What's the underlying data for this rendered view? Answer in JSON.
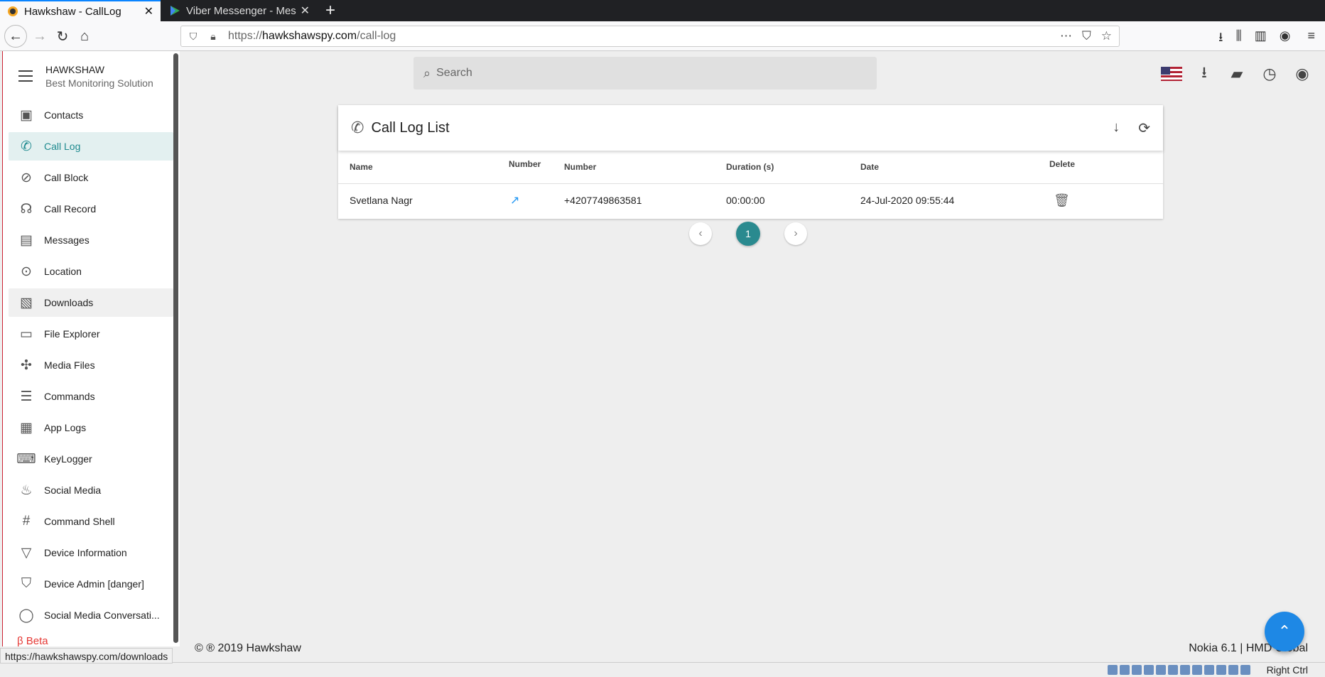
{
  "browser": {
    "tabs": [
      {
        "title": "Hawkshaw - CallLog",
        "active": true
      },
      {
        "title": "Viber Messenger - Messa",
        "active": false
      }
    ],
    "url_prefix": "https://",
    "url_domain": "hawkshawspy.com",
    "url_path": "/call-log",
    "status_url": "https://hawkshawspy.com/downloads"
  },
  "sidebar": {
    "brand_name": "HAWKSHAW",
    "brand_sub": "Best Monitoring Solution",
    "items": [
      {
        "label": "Contacts",
        "icon": "contacts-icon",
        "glyph": "▣"
      },
      {
        "label": "Call Log",
        "icon": "phone-icon",
        "glyph": "✆",
        "active": true
      },
      {
        "label": "Call Block",
        "icon": "block-icon",
        "glyph": "⊘"
      },
      {
        "label": "Call Record",
        "icon": "record-voice-icon",
        "glyph": "☊"
      },
      {
        "label": "Messages",
        "icon": "message-icon",
        "glyph": "▤"
      },
      {
        "label": "Location",
        "icon": "location-icon",
        "glyph": "⊙"
      },
      {
        "label": "Downloads",
        "icon": "photo-library-icon",
        "glyph": "▧",
        "hover": true
      },
      {
        "label": "File Explorer",
        "icon": "folder-icon",
        "glyph": "▭"
      },
      {
        "label": "Media Files",
        "icon": "pinwheel-icon",
        "glyph": "✣"
      },
      {
        "label": "Commands",
        "icon": "list-icon",
        "glyph": "☰"
      },
      {
        "label": "App Logs",
        "icon": "log-list-icon",
        "glyph": "▦"
      },
      {
        "label": "KeyLogger",
        "icon": "keyboard-icon",
        "glyph": "⌨"
      },
      {
        "label": "Social Media",
        "icon": "flame-icon",
        "glyph": "♨"
      },
      {
        "label": "Command Shell",
        "icon": "hash-icon",
        "glyph": "#"
      },
      {
        "label": "Device Information",
        "icon": "triangle-icon",
        "glyph": "▽"
      },
      {
        "label": "Device Admin [danger]",
        "icon": "shield-icon",
        "glyph": "⛉"
      },
      {
        "label": "Social Media Conversati...",
        "icon": "whatsapp-icon",
        "glyph": "◯"
      }
    ],
    "beta_label": "β Beta"
  },
  "header": {
    "search_placeholder": "Search"
  },
  "call_log": {
    "title": "Call Log List",
    "columns": {
      "name": "Name",
      "direction": "Number",
      "number": "Number",
      "duration": "Duration (s)",
      "date": "Date",
      "delete": "Delete"
    },
    "rows": [
      {
        "name": "Svetlana Nagr",
        "direction": "↗",
        "number": "+4207749863581",
        "duration": "00:00:00",
        "date": "24-Jul-2020 09:55:44"
      }
    ],
    "current_page": "1"
  },
  "footer": {
    "copyright": "© ® 2019 Hawkshaw",
    "device": "Nokia 6.1 | HMD Global"
  },
  "vm": {
    "host_key": "Right Ctrl"
  },
  "colors": {
    "accent": "#2a8a8f",
    "fab": "#1e88e5",
    "beta": "#e53935"
  }
}
